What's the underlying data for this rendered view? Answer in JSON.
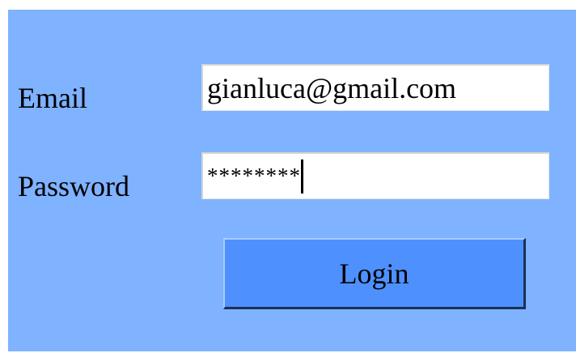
{
  "form": {
    "email_label": "Email",
    "email_value": "gianluca@gmail.com",
    "password_label": "Password",
    "password_masked": "********",
    "login_label": "Login"
  },
  "colors": {
    "panel_background": "#7fb2ff",
    "button_background": "#4d90fe",
    "field_background": "#ffffff"
  }
}
